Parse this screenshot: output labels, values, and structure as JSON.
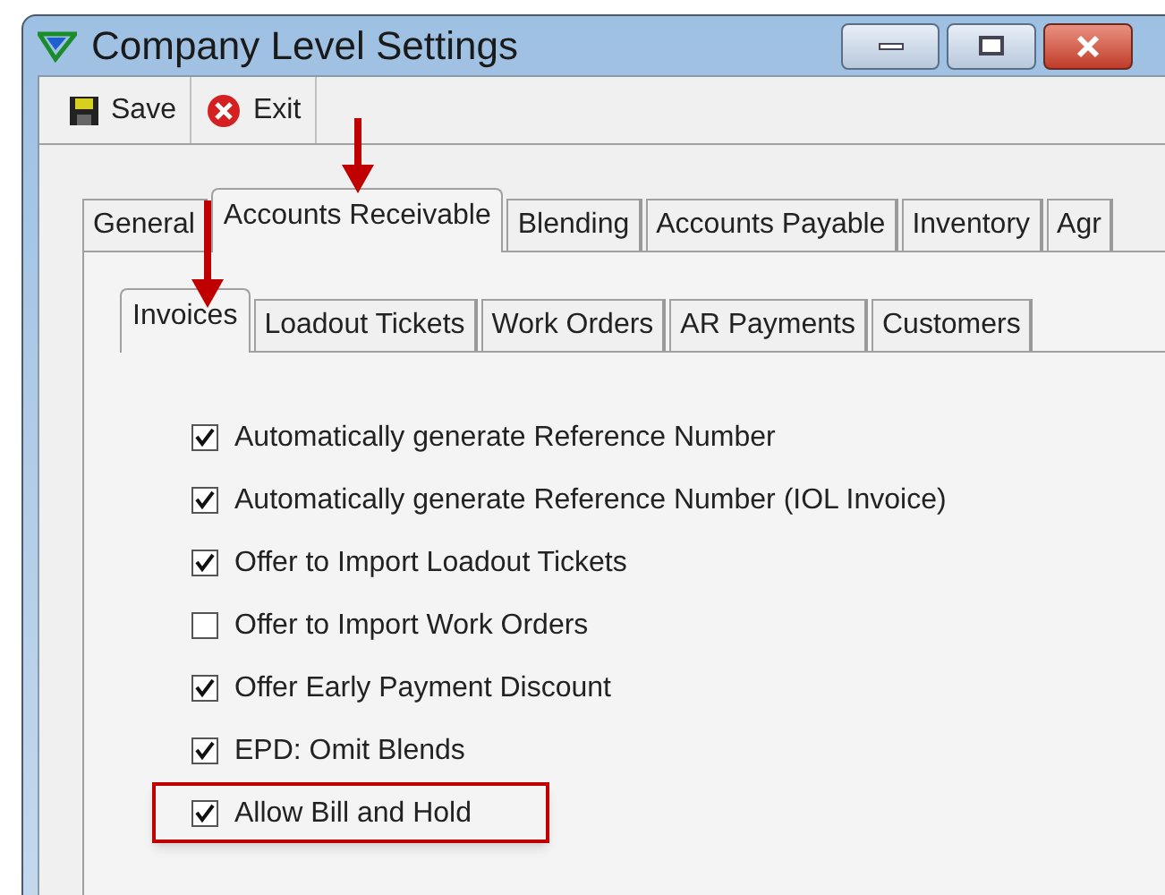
{
  "window": {
    "title": "Company Level Settings"
  },
  "toolbar": [
    {
      "kind": "save",
      "label": "Save"
    },
    {
      "kind": "exit",
      "label": "Exit"
    }
  ],
  "tabs": [
    {
      "label": "General",
      "selected": false
    },
    {
      "label": "Accounts Receivable",
      "selected": true
    },
    {
      "label": "Blending",
      "selected": false
    },
    {
      "label": "Accounts Payable",
      "selected": false
    },
    {
      "label": "Inventory",
      "selected": false
    },
    {
      "label": "Agr",
      "selected": false
    }
  ],
  "subtabs": [
    {
      "label": "Invoices",
      "selected": true
    },
    {
      "label": "Loadout Tickets",
      "selected": false
    },
    {
      "label": "Work Orders",
      "selected": false
    },
    {
      "label": "AR Payments",
      "selected": false
    },
    {
      "label": "Customers",
      "selected": false
    }
  ],
  "options": [
    {
      "label": "Automatically generate Reference Number",
      "checked": true,
      "highlighted": false
    },
    {
      "label": "Automatically generate Reference Number (IOL Invoice)",
      "checked": true,
      "highlighted": false
    },
    {
      "label": "Offer to Import Loadout Tickets",
      "checked": true,
      "highlighted": false
    },
    {
      "label": "Offer to Import Work Orders",
      "checked": false,
      "highlighted": false
    },
    {
      "label": "Offer Early Payment Discount",
      "checked": true,
      "highlighted": false
    },
    {
      "label": "EPD: Omit Blends",
      "checked": true,
      "highlighted": false
    },
    {
      "label": "Allow Bill and Hold",
      "checked": true,
      "highlighted": true
    }
  ]
}
